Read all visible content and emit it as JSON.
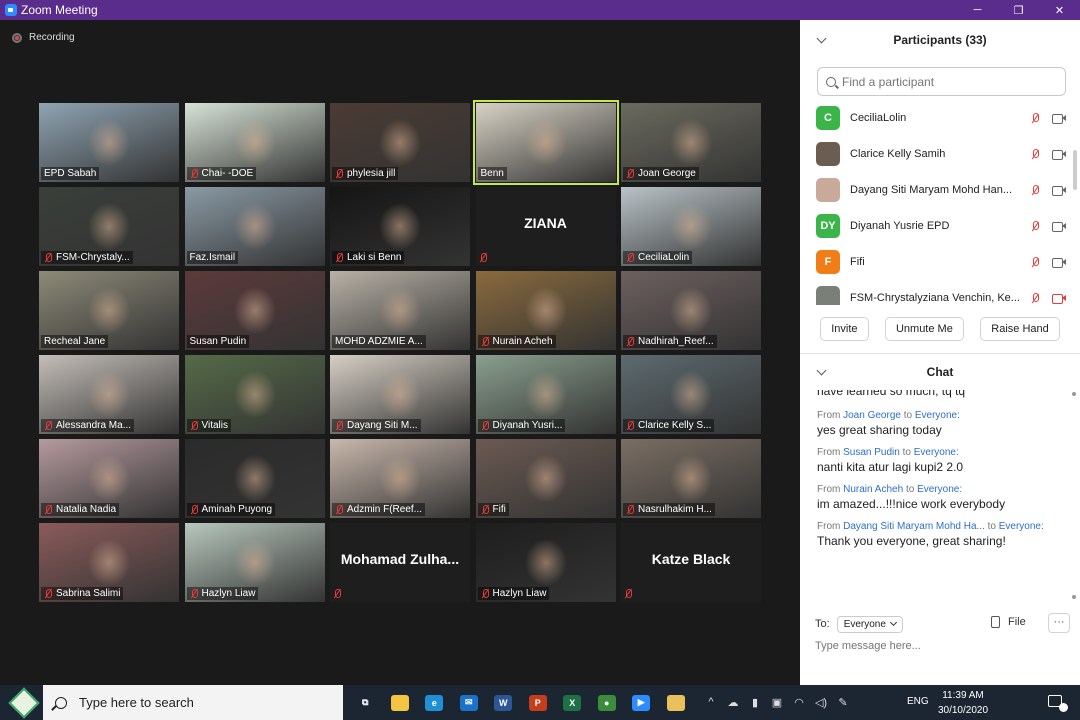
{
  "window": {
    "title": "Zoom Meeting",
    "controls": [
      "─",
      "❐",
      "✕"
    ]
  },
  "recording": {
    "label": "Recording"
  },
  "tiles": [
    {
      "name": "EPD Sabah",
      "muted": false,
      "bg": "#8fa4b3"
    },
    {
      "name": "Chai- -DOE",
      "muted": true,
      "bg": "#d7e3d6"
    },
    {
      "name": "phylesia jill",
      "muted": true,
      "bg": "#4b3b33"
    },
    {
      "name": "Benn",
      "muted": false,
      "bg": "#d9d3c5",
      "active": true
    },
    {
      "name": "Joan George",
      "muted": true,
      "bg": "#6b6a5e"
    },
    {
      "name": "FSM-Chrystaly...",
      "muted": true,
      "bg": "#3a3f3a"
    },
    {
      "name": "Faz.Ismail",
      "muted": false,
      "bg": "#8a9aa5"
    },
    {
      "name": "Laki si Benn",
      "muted": true,
      "bg": "#151515"
    },
    {
      "name": "",
      "big": "ZIANA",
      "muted": true,
      "bg": "#232323"
    },
    {
      "name": "CeciliaLolin",
      "muted": true,
      "bg": "#b9c3c7"
    },
    {
      "name": "Recheal Jane",
      "muted": false,
      "bg": "#8d8a78"
    },
    {
      "name": "Susan Pudin",
      "muted": false,
      "bg": "#5d3a3b"
    },
    {
      "name": "MOHD ADZMIE A...",
      "muted": false,
      "bg": "#b8b1a6"
    },
    {
      "name": "Nurain Acheh",
      "muted": true,
      "bg": "#8a6a3d"
    },
    {
      "name": "Nadhirah_Reef...",
      "muted": true,
      "bg": "#6d605f"
    },
    {
      "name": "Alessandra Ma...",
      "muted": true,
      "bg": "#c4beb8"
    },
    {
      "name": "Vitalis",
      "muted": true,
      "bg": "#556b48"
    },
    {
      "name": "Dayang Siti M...",
      "muted": true,
      "bg": "#d6cfc4"
    },
    {
      "name": "Diyanah Yusri...",
      "muted": true,
      "bg": "#8aa08e"
    },
    {
      "name": "Clarice Kelly S...",
      "muted": true,
      "bg": "#5d6b70"
    },
    {
      "name": "Natalia Nadia",
      "muted": true,
      "bg": "#b59a9e"
    },
    {
      "name": "Aminah Puyong",
      "muted": true,
      "bg": "#2b2b2b"
    },
    {
      "name": "Adzmin F(Reef...",
      "muted": true,
      "bg": "#c9b8ac"
    },
    {
      "name": "Fifi",
      "muted": true,
      "bg": "#6c5a52"
    },
    {
      "name": "Nasrulhakim H...",
      "muted": true,
      "bg": "#7b6e63"
    },
    {
      "name": "Sabrina Salimi",
      "muted": true,
      "bg": "#8a5b5a"
    },
    {
      "name": "Hazlyn Liaw",
      "muted": true,
      "bg": "#b8c8bd"
    },
    {
      "name": "",
      "big": "Mohamad  Zulha...",
      "muted": true,
      "bg": "#232323"
    },
    {
      "name": "Hazlyn Liaw",
      "muted": true,
      "bg": "#1e1e1e"
    },
    {
      "name": "",
      "big": "Katze Black",
      "muted": true,
      "bg": "#232323"
    }
  ],
  "participants": {
    "header": "Participants (33)",
    "search_placeholder": "Find a participant",
    "list": [
      {
        "name": "CeciliaLolin",
        "initials": "C",
        "avatar_color": "#3bb54a",
        "cam_off": false
      },
      {
        "name": "Clarice Kelly Samih",
        "initials": "",
        "avatar_color": "#6b5d52",
        "cam_off": false
      },
      {
        "name": "Dayang Siti Maryam Mohd Han...",
        "initials": "",
        "avatar_color": "#c9a99a",
        "cam_off": false
      },
      {
        "name": "Diyanah Yusrie EPD",
        "initials": "DY",
        "avatar_color": "#3bb54a",
        "cam_off": false
      },
      {
        "name": "Fifi",
        "initials": "F",
        "avatar_color": "#f07d18",
        "cam_off": false
      },
      {
        "name": "FSM-Chrystalyziana Venchin, Ke...",
        "initials": "",
        "avatar_color": "#7a7f77",
        "cam_off": true
      }
    ],
    "buttons": {
      "invite": "Invite",
      "unmute": "Unmute Me",
      "raise": "Raise Hand"
    }
  },
  "chat": {
    "header": "Chat",
    "partial_text": "have learned so much, tq tq",
    "messages": [
      {
        "from_label": "From",
        "sender": "Joan George",
        "to_label": "to",
        "recipient": "Everyone:",
        "text": "yes great sharing today"
      },
      {
        "from_label": "From",
        "sender": "Susan Pudin",
        "to_label": "to",
        "recipient": "Everyone:",
        "text": "nanti kita atur lagi kupi2 2.0"
      },
      {
        "from_label": "From",
        "sender": "Nurain Acheh",
        "to_label": "to",
        "recipient": "Everyone:",
        "text": "im amazed...!!!nice work everybody"
      },
      {
        "from_label": "From",
        "sender": "Dayang Siti Maryam Mohd Ha...",
        "to_label": "to",
        "recipient": "Everyone:",
        "text": "Thank you everyone, great sharing!"
      }
    ],
    "to_label": "To:",
    "to_value": "Everyone",
    "file_label": "File",
    "more_label": "···",
    "input_placeholder": "Type message here..."
  },
  "taskbar": {
    "search_placeholder": "Type here to search",
    "apps": [
      {
        "name": "task-view",
        "glyph": "⧉",
        "color": "#1c2633"
      },
      {
        "name": "file-explorer",
        "glyph": "",
        "color": "#f4c542"
      },
      {
        "name": "edge",
        "glyph": "e",
        "color": "#1f8fd6"
      },
      {
        "name": "mail",
        "glyph": "✉",
        "color": "#1a73c8"
      },
      {
        "name": "word",
        "glyph": "W",
        "color": "#2b5797"
      },
      {
        "name": "powerpoint",
        "glyph": "P",
        "color": "#c43e1c"
      },
      {
        "name": "excel",
        "glyph": "X",
        "color": "#1e7145"
      },
      {
        "name": "chrome",
        "glyph": "●",
        "color": "#3b8c3b"
      },
      {
        "name": "zoom",
        "glyph": "▶",
        "color": "#2d8cff"
      },
      {
        "name": "files",
        "glyph": "",
        "color": "#e8c15a"
      }
    ],
    "tray_icons": [
      "^",
      "☁",
      "▮",
      "▣",
      "◠",
      "◁)",
      "✎"
    ],
    "language": "ENG",
    "time": "11:39 AM",
    "date": "30/10/2020"
  }
}
